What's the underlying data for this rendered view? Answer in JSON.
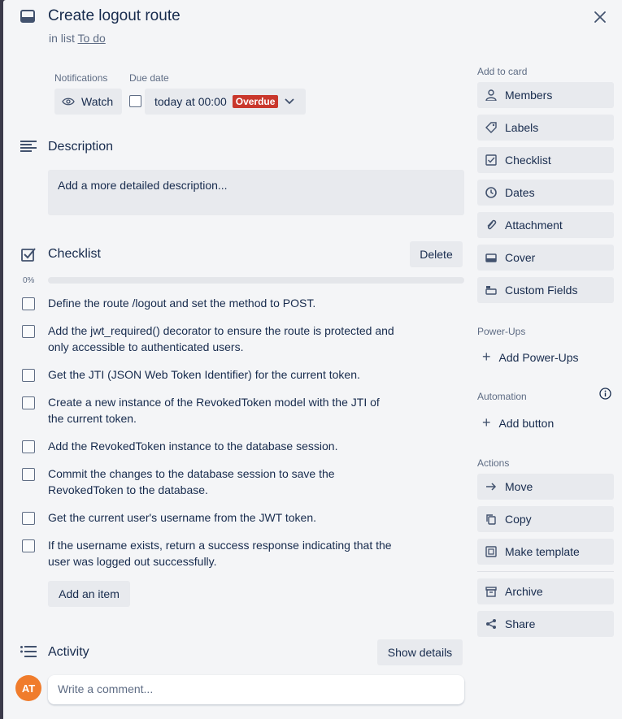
{
  "card": {
    "title": "Create logout route",
    "in_list_prefix": "in list",
    "list_name": "To do"
  },
  "meta": {
    "notifications_label": "Notifications",
    "watch_label": "Watch",
    "due_date_label": "Due date",
    "due_value": "today at 00:00",
    "due_status": "Overdue"
  },
  "description": {
    "title": "Description",
    "placeholder": "Add a more detailed description..."
  },
  "checklist": {
    "title": "Checklist",
    "delete_label": "Delete",
    "progress_text": "0%",
    "progress": 0,
    "items": [
      {
        "text": "Define the route /logout and set the method to POST."
      },
      {
        "text": "Add the jwt_required() decorator to ensure the route is protected and only accessible to authenticated users."
      },
      {
        "text": "Get the JTI (JSON Web Token Identifier) for the current token."
      },
      {
        "text": "Create a new instance of the RevokedToken model with the JTI of the current token."
      },
      {
        "text": "Add the RevokedToken instance to the database session."
      },
      {
        "text": "Commit the changes to the database session to save the RevokedToken to the database."
      },
      {
        "text": "Get the current user's username from the JWT token."
      },
      {
        "text": "If the username exists, return a success response indicating that the user was logged out successfully."
      }
    ],
    "add_item_label": "Add an item"
  },
  "activity": {
    "title": "Activity",
    "show_details_label": "Show details",
    "avatar_initials": "AT",
    "comment_placeholder": "Write a comment..."
  },
  "sidebar": {
    "add_to_card_label": "Add to card",
    "add_to_card": [
      {
        "label": "Members",
        "icon": "person-icon"
      },
      {
        "label": "Labels",
        "icon": "tag-icon"
      },
      {
        "label": "Checklist",
        "icon": "checkbox-icon"
      },
      {
        "label": "Dates",
        "icon": "clock-icon"
      },
      {
        "label": "Attachment",
        "icon": "paperclip-icon"
      },
      {
        "label": "Cover",
        "icon": "cover-icon"
      },
      {
        "label": "Custom Fields",
        "icon": "custom-fields-icon"
      }
    ],
    "powerups_label": "Power-Ups",
    "add_powerups_label": "Add Power-Ups",
    "automation_label": "Automation",
    "add_button_label": "Add button",
    "actions_label": "Actions",
    "actions": [
      {
        "label": "Move",
        "icon": "arrow-right-icon"
      },
      {
        "label": "Copy",
        "icon": "copy-icon"
      },
      {
        "label": "Make template",
        "icon": "template-icon"
      },
      {
        "label": "Archive",
        "icon": "archive-icon"
      },
      {
        "label": "Share",
        "icon": "share-icon"
      }
    ]
  },
  "colors": {
    "modal_bg": "#f4f5f7",
    "button_bg": "#e8eaee",
    "overdue": "#c9372c",
    "avatar": "#f07c2c",
    "text": "#172b4d",
    "muted": "#5e6c84"
  }
}
